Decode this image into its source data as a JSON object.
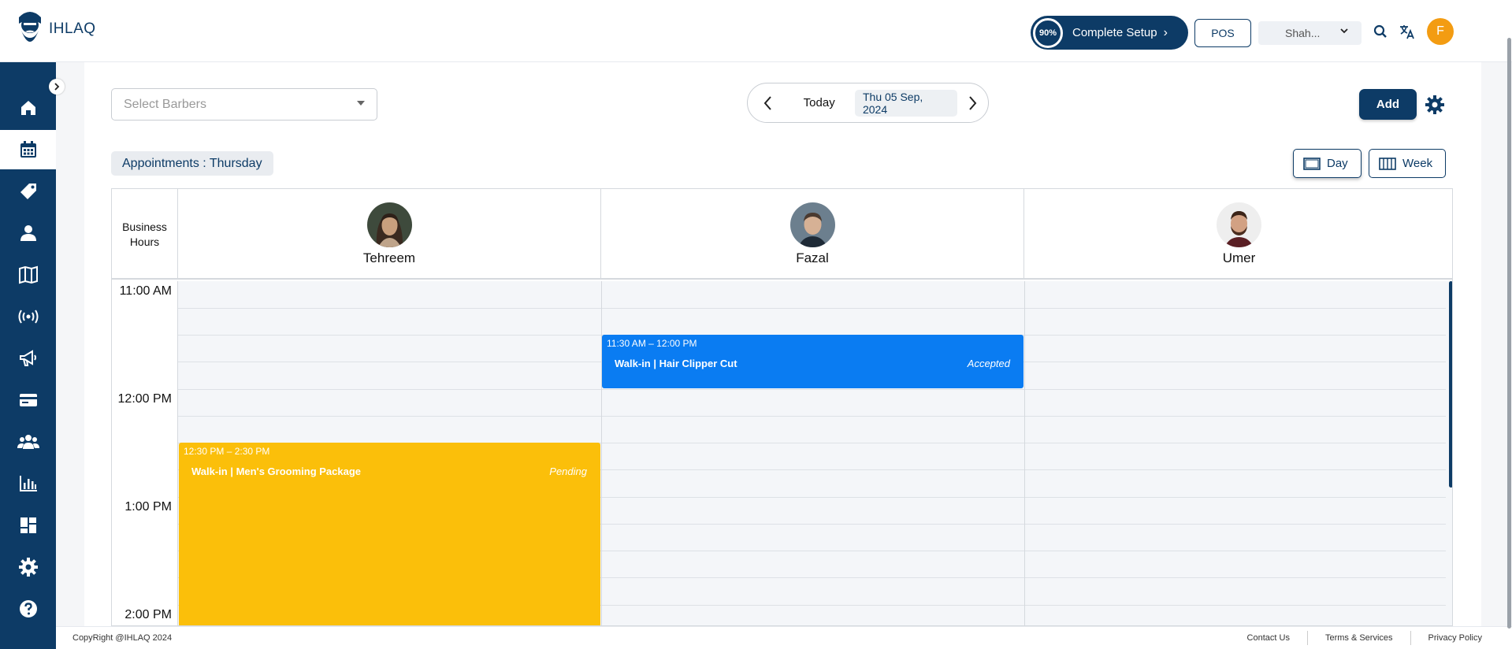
{
  "brand": {
    "name": "IHLAQ"
  },
  "header": {
    "setup_percent": "90%",
    "setup_label": "Complete Setup",
    "pos_label": "POS",
    "shop_selected": "Shah...",
    "avatar_initial": "F"
  },
  "sidebar": {
    "items": [
      {
        "icon": "home-icon"
      },
      {
        "icon": "calendar-icon",
        "active": true
      },
      {
        "icon": "tag-icon"
      },
      {
        "icon": "user-icon"
      },
      {
        "icon": "book-icon"
      },
      {
        "icon": "broadcast-icon"
      },
      {
        "icon": "megaphone-icon"
      },
      {
        "icon": "card-icon"
      },
      {
        "icon": "team-icon"
      },
      {
        "icon": "analytics-icon"
      },
      {
        "icon": "dashboard-icon"
      },
      {
        "icon": "settings-icon"
      },
      {
        "icon": "help-icon"
      }
    ]
  },
  "toolbar": {
    "barber_placeholder": "Select Barbers",
    "today_label": "Today",
    "date_label": "Thu 05 Sep, 2024",
    "add_label": "Add"
  },
  "appointments": {
    "label": "Appointments : Thursday",
    "view_day": "Day",
    "view_week": "Week"
  },
  "calendar": {
    "business_hours_label": "Business Hours",
    "barbers": [
      {
        "name": "Tehreem"
      },
      {
        "name": "Fazal"
      },
      {
        "name": "Umer"
      }
    ],
    "time_labels": [
      "11:00 AM",
      "12:00 PM",
      "1:00 PM",
      "2:00 PM"
    ],
    "events": [
      {
        "barber": "Fazal",
        "time": "11:30 AM – 12:00 PM",
        "title": "Walk-in | Hair Clipper Cut",
        "status": "Accepted",
        "color": "#0a7cf2"
      },
      {
        "barber": "Tehreem",
        "time": "12:30 PM – 2:30 PM",
        "title": "Walk-in | Men's Grooming Package",
        "status": "Pending",
        "color": "#fbbf0a"
      }
    ]
  },
  "footer": {
    "copyright": "CopyRight @IHLAQ 2024",
    "links": [
      "Contact Us",
      "Terms & Services",
      "Privacy Policy"
    ]
  },
  "colors": {
    "primary": "#0d3b66",
    "accent": "#f39c12",
    "event_blue": "#0a7cf2",
    "event_yellow": "#fbbf0a"
  }
}
